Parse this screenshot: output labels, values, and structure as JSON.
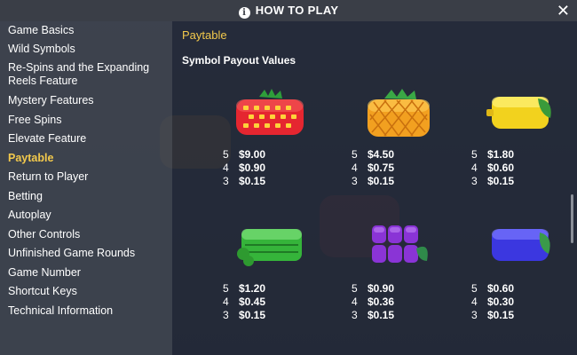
{
  "header": {
    "title": "HOW TO PLAY"
  },
  "sidebar": {
    "items": [
      {
        "label": "Game Basics"
      },
      {
        "label": "Wild Symbols"
      },
      {
        "label": "Re-Spins and the Expanding Reels Feature"
      },
      {
        "label": "Mystery Features"
      },
      {
        "label": "Free Spins"
      },
      {
        "label": "Elevate Feature"
      },
      {
        "label": "Paytable"
      },
      {
        "label": "Return to Player"
      },
      {
        "label": "Betting"
      },
      {
        "label": "Autoplay"
      },
      {
        "label": "Other Controls"
      },
      {
        "label": "Unfinished Game Rounds"
      },
      {
        "label": "Game Number"
      },
      {
        "label": "Shortcut Keys"
      },
      {
        "label": "Technical Information"
      }
    ],
    "active_item": "Paytable"
  },
  "main": {
    "section_title": "Paytable",
    "subtitle": "Symbol Payout Values",
    "symbols": [
      {
        "icon": "strawberry-icon",
        "payouts": [
          {
            "count": "5",
            "value": "$9.00"
          },
          {
            "count": "4",
            "value": "$0.90"
          },
          {
            "count": "3",
            "value": "$0.15"
          }
        ]
      },
      {
        "icon": "pineapple-icon",
        "payouts": [
          {
            "count": "5",
            "value": "$4.50"
          },
          {
            "count": "4",
            "value": "$0.75"
          },
          {
            "count": "3",
            "value": "$0.15"
          }
        ]
      },
      {
        "icon": "lemon-icon",
        "payouts": [
          {
            "count": "5",
            "value": "$1.80"
          },
          {
            "count": "4",
            "value": "$0.60"
          },
          {
            "count": "3",
            "value": "$0.15"
          }
        ]
      },
      {
        "icon": "lime-icon",
        "payouts": [
          {
            "count": "5",
            "value": "$1.20"
          },
          {
            "count": "4",
            "value": "$0.45"
          },
          {
            "count": "3",
            "value": "$0.15"
          }
        ]
      },
      {
        "icon": "grapes-icon",
        "payouts": [
          {
            "count": "5",
            "value": "$0.90"
          },
          {
            "count": "4",
            "value": "$0.36"
          },
          {
            "count": "3",
            "value": "$0.15"
          }
        ]
      },
      {
        "icon": "plum-icon",
        "payouts": [
          {
            "count": "5",
            "value": "$0.60"
          },
          {
            "count": "4",
            "value": "$0.30"
          },
          {
            "count": "3",
            "value": "$0.15"
          }
        ]
      }
    ]
  },
  "colors": {
    "accent": "#f2c94c",
    "sidebar_bg": "#404650",
    "text": "#ffffff"
  }
}
